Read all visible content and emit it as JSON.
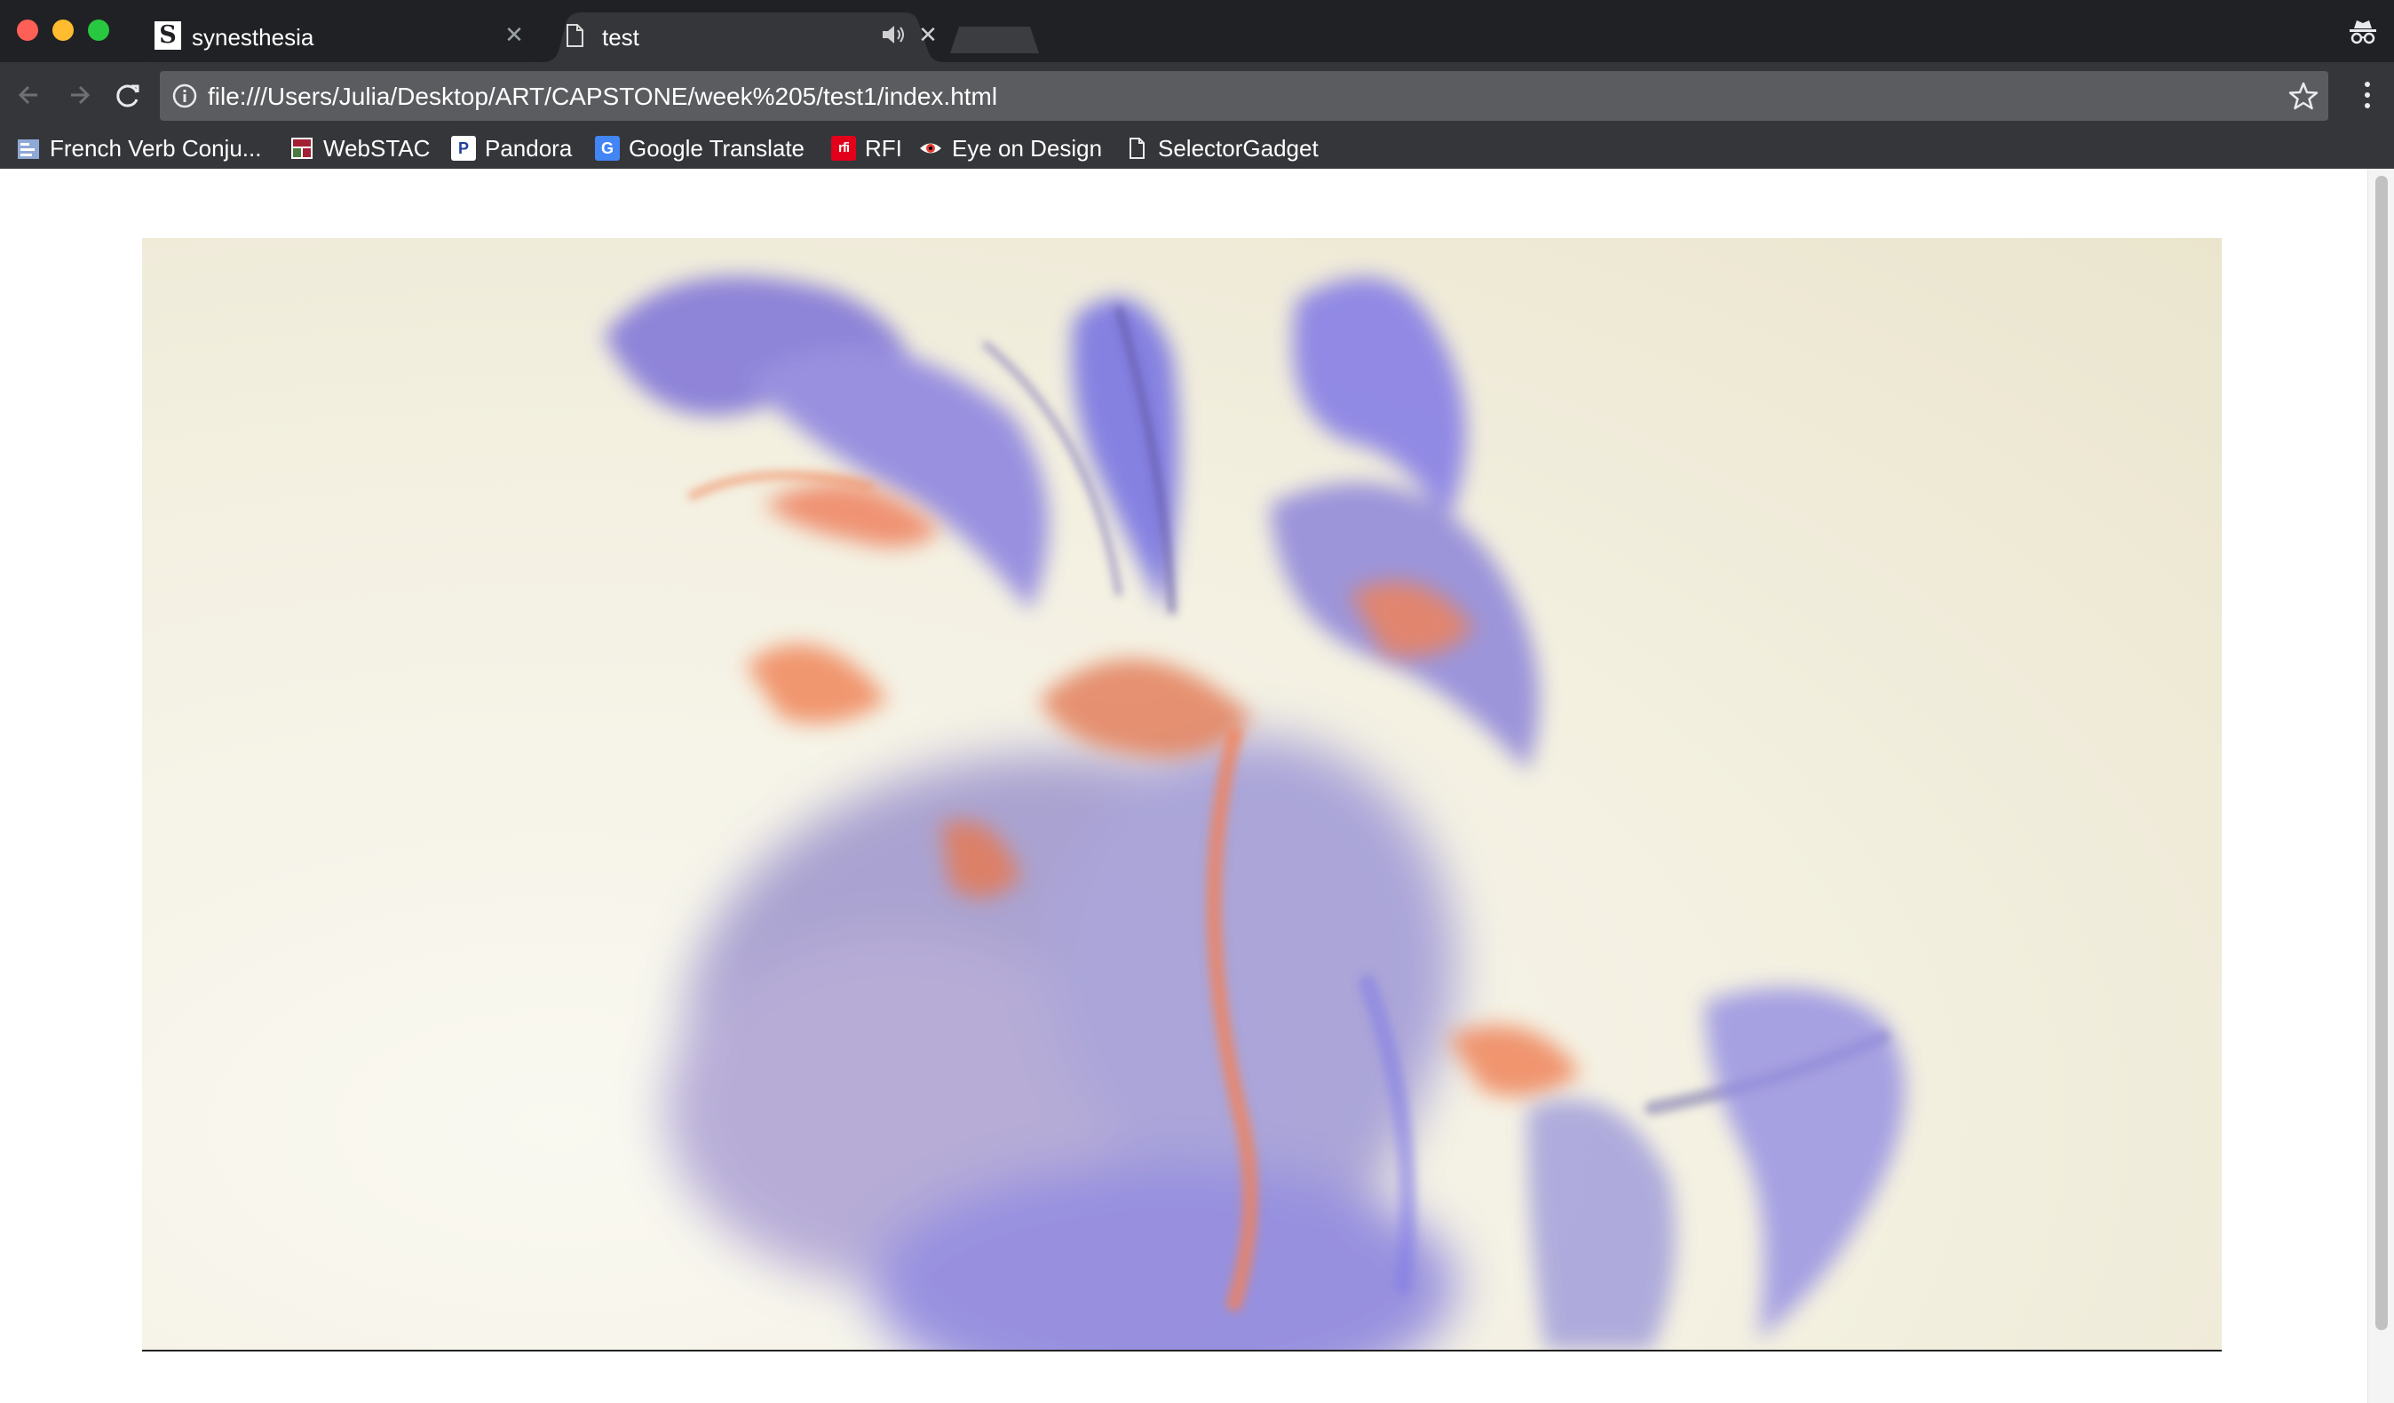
{
  "window": {
    "traffic_lights": [
      "close",
      "minimize",
      "zoom"
    ]
  },
  "tabs": [
    {
      "title": "synesthesia",
      "favicon_letter": "S",
      "favicon": "site-s-icon",
      "active": false
    },
    {
      "title": "test",
      "favicon": "page-icon",
      "audio": "speaker-icon",
      "active": true
    }
  ],
  "toolbar": {
    "url": "file:///Users/Julia/Desktop/ART/CAPSTONE/week%205/test1/index.html"
  },
  "bookmarks": [
    {
      "label": "French Verb Conju...",
      "icon": "french-verb-icon"
    },
    {
      "label": "WebSTAC",
      "icon": "webstac-icon"
    },
    {
      "label": "Pandora",
      "icon_letter": "P",
      "icon": "pandora-icon"
    },
    {
      "label": "Google Translate",
      "icon_letter": "G",
      "icon": "google-translate-icon"
    },
    {
      "label": "RFI",
      "icon_letter": "rfi",
      "icon": "rfi-icon"
    },
    {
      "label": "Eye on Design",
      "icon": "eye-icon"
    },
    {
      "label": "SelectorGadget",
      "icon": "page-icon"
    }
  ],
  "colors": {
    "titlebar": "#202124",
    "toolbar": "#35363a",
    "omnibox": "#5b5c60",
    "ink_purple": "#6a62e8",
    "ink_orange": "#f0603a"
  },
  "page": {
    "media": "video-frame-ink-in-water"
  }
}
